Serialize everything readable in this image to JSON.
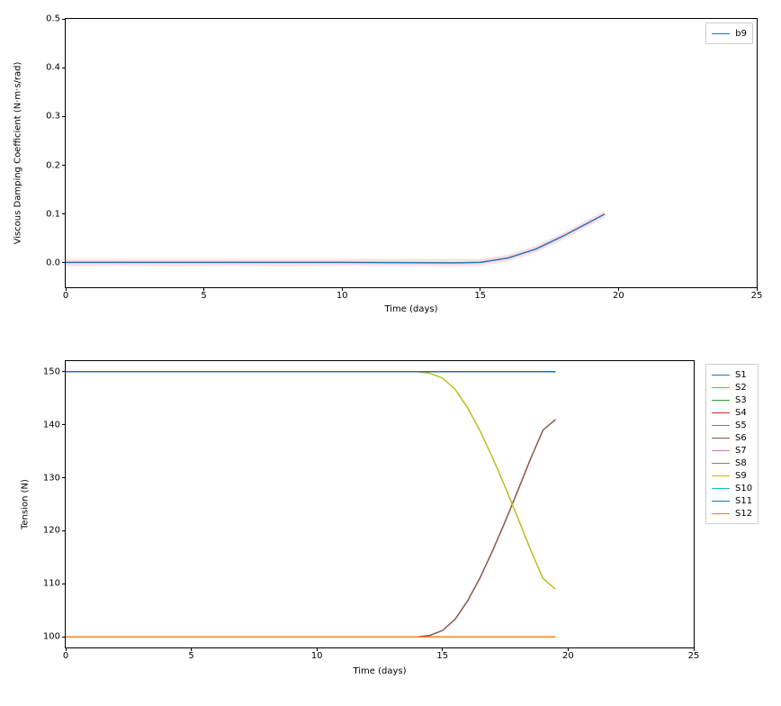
{
  "chart_data": [
    {
      "type": "line",
      "title": "",
      "xlabel": "Time (days)",
      "ylabel": "Viscous Damping Coefficient (N·m·s/rad)",
      "xlim": [
        0,
        25
      ],
      "ylim": [
        -0.05,
        0.5
      ],
      "xticks": [
        0,
        5,
        10,
        15,
        20,
        25
      ],
      "yticks": [
        0.0,
        0.1,
        0.2,
        0.3,
        0.4,
        0.5
      ],
      "legend_position": "upper-right",
      "series": [
        {
          "name": "b9",
          "color": "#1f77b4",
          "x": [
            0,
            5,
            10,
            14,
            15,
            16,
            17,
            18,
            19,
            19.5
          ],
          "y": [
            0.001,
            0.001,
            0.001,
            0.0,
            0.001,
            0.01,
            0.028,
            0.055,
            0.085,
            0.1
          ]
        }
      ],
      "fill_band": {
        "color": "#ff9eb0",
        "opacity": 0.35,
        "x": [
          0,
          2,
          4,
          6,
          8,
          10,
          12,
          14,
          15,
          16,
          17,
          18,
          19,
          19.5
        ],
        "y_low": [
          -0.007,
          -0.006,
          -0.007,
          -0.006,
          -0.007,
          -0.006,
          -0.006,
          -0.007,
          -0.006,
          0.003,
          0.021,
          0.048,
          0.078,
          0.093
        ],
        "y_high": [
          0.008,
          0.008,
          0.008,
          0.008,
          0.008,
          0.008,
          0.008,
          0.008,
          0.008,
          0.017,
          0.035,
          0.062,
          0.092,
          0.107
        ]
      }
    },
    {
      "type": "line",
      "title": "",
      "xlabel": "Time (days)",
      "ylabel": "Tension (N)",
      "xlim": [
        0,
        25
      ],
      "ylim": [
        98,
        152
      ],
      "xticks": [
        0,
        5,
        10,
        15,
        20,
        25
      ],
      "yticks": [
        100,
        110,
        120,
        130,
        140,
        150
      ],
      "legend_position": "right-outside",
      "series": [
        {
          "name": "S1",
          "color": "#1f77b4",
          "x": [
            0,
            19.5
          ],
          "y": [
            150,
            150
          ]
        },
        {
          "name": "S2",
          "color": "#ff7f0e",
          "x": [
            0,
            19.5
          ],
          "y": [
            100,
            100
          ]
        },
        {
          "name": "S3",
          "color": "#2ca02c",
          "x": [
            0,
            19.5
          ],
          "y": [
            150,
            150
          ]
        },
        {
          "name": "S4",
          "color": "#d62728",
          "x": [
            0,
            19.5
          ],
          "y": [
            100,
            100
          ]
        },
        {
          "name": "S5",
          "color": "#9467bd",
          "x": [
            0,
            19.5
          ],
          "y": [
            150,
            150
          ]
        },
        {
          "name": "S6",
          "color": "#8c564b",
          "x": [
            0,
            14,
            14.5,
            15,
            15.5,
            16,
            16.5,
            17,
            17.5,
            18,
            18.5,
            19,
            19.5
          ],
          "y": [
            100.0,
            100.0,
            100.3,
            101.2,
            103.3,
            106.8,
            111.2,
            116.3,
            121.8,
            127.6,
            133.5,
            139.0,
            141.0
          ]
        },
        {
          "name": "S7",
          "color": "#e377c2",
          "x": [
            0,
            19.5
          ],
          "y": [
            150,
            150
          ]
        },
        {
          "name": "S8",
          "color": "#7f7f7f",
          "x": [
            0,
            19.5
          ],
          "y": [
            100,
            100
          ]
        },
        {
          "name": "S9",
          "color": "#bcbd22",
          "x": [
            0,
            14,
            14.5,
            15,
            15.5,
            16,
            16.5,
            17,
            17.5,
            18,
            18.5,
            19,
            19.5
          ],
          "y": [
            150.0,
            150.0,
            149.7,
            148.8,
            146.7,
            143.2,
            138.8,
            133.7,
            128.2,
            122.4,
            116.5,
            111.0,
            109.0
          ]
        },
        {
          "name": "S10",
          "color": "#17becf",
          "x": [
            0,
            19.5
          ],
          "y": [
            150,
            150
          ]
        },
        {
          "name": "S11",
          "color": "#1f77b4",
          "x": [
            0,
            19.5
          ],
          "y": [
            150,
            150
          ]
        },
        {
          "name": "S12",
          "color": "#ff7f0e",
          "x": [
            0,
            19.5
          ],
          "y": [
            100,
            100
          ]
        }
      ]
    }
  ],
  "top": {
    "xlabel": "Time (days)",
    "ylabel": "Viscous Damping Coefficient (N·m·s/rad)",
    "xticks": [
      "0",
      "5",
      "10",
      "15",
      "20",
      "25"
    ],
    "yticks": [
      "0.0",
      "0.1",
      "0.2",
      "0.3",
      "0.4",
      "0.5"
    ],
    "legend": {
      "b9": "b9"
    }
  },
  "bottom": {
    "xlabel": "Time (days)",
    "ylabel": "Tension (N)",
    "xticks": [
      "0",
      "5",
      "10",
      "15",
      "20",
      "25"
    ],
    "yticks": [
      "100",
      "110",
      "120",
      "130",
      "140",
      "150"
    ],
    "legend": {
      "S1": "S1",
      "S2": "S2",
      "S3": "S3",
      "S4": "S4",
      "S5": "S5",
      "S6": "S6",
      "S7": "S7",
      "S8": "S8",
      "S9": "S9",
      "S10": "S10",
      "S11": "S11",
      "S12": "S12"
    }
  }
}
